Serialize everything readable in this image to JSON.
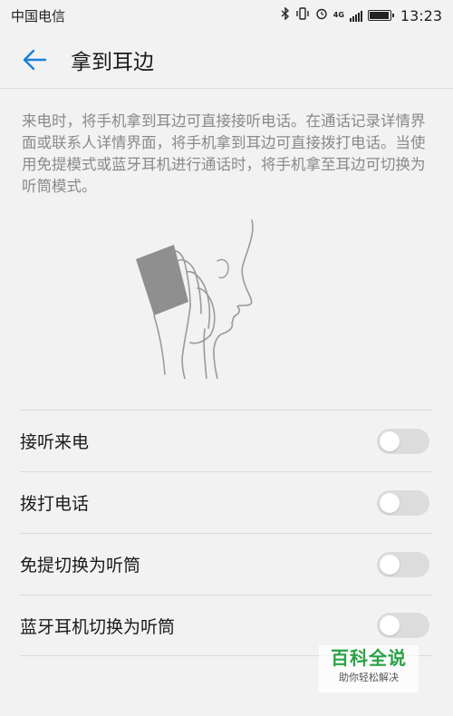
{
  "status_bar": {
    "carrier": "中国电信",
    "network": "4G",
    "time": "13:23",
    "battery_level": 0.95
  },
  "header": {
    "title": "拿到耳边",
    "back_icon": "arrow-left-icon",
    "accent_color": "#1a7fd8"
  },
  "description": "来电时，将手机拿到耳边可直接接听电话。在通话记录详情界面或联系人详情界面，将手机拿到耳边可直接拨打电话。当使用免提模式或蓝牙耳机进行通话时，将手机拿至耳边可切换为听筒模式。",
  "settings": [
    {
      "label": "接听来电",
      "enabled": false
    },
    {
      "label": "拨打电话",
      "enabled": false
    },
    {
      "label": "免提切换为听筒",
      "enabled": false
    },
    {
      "label": "蓝牙耳机切换为听筒",
      "enabled": false
    }
  ],
  "watermark": {
    "title": "百科全说",
    "subtitle": "助你轻松解决"
  }
}
